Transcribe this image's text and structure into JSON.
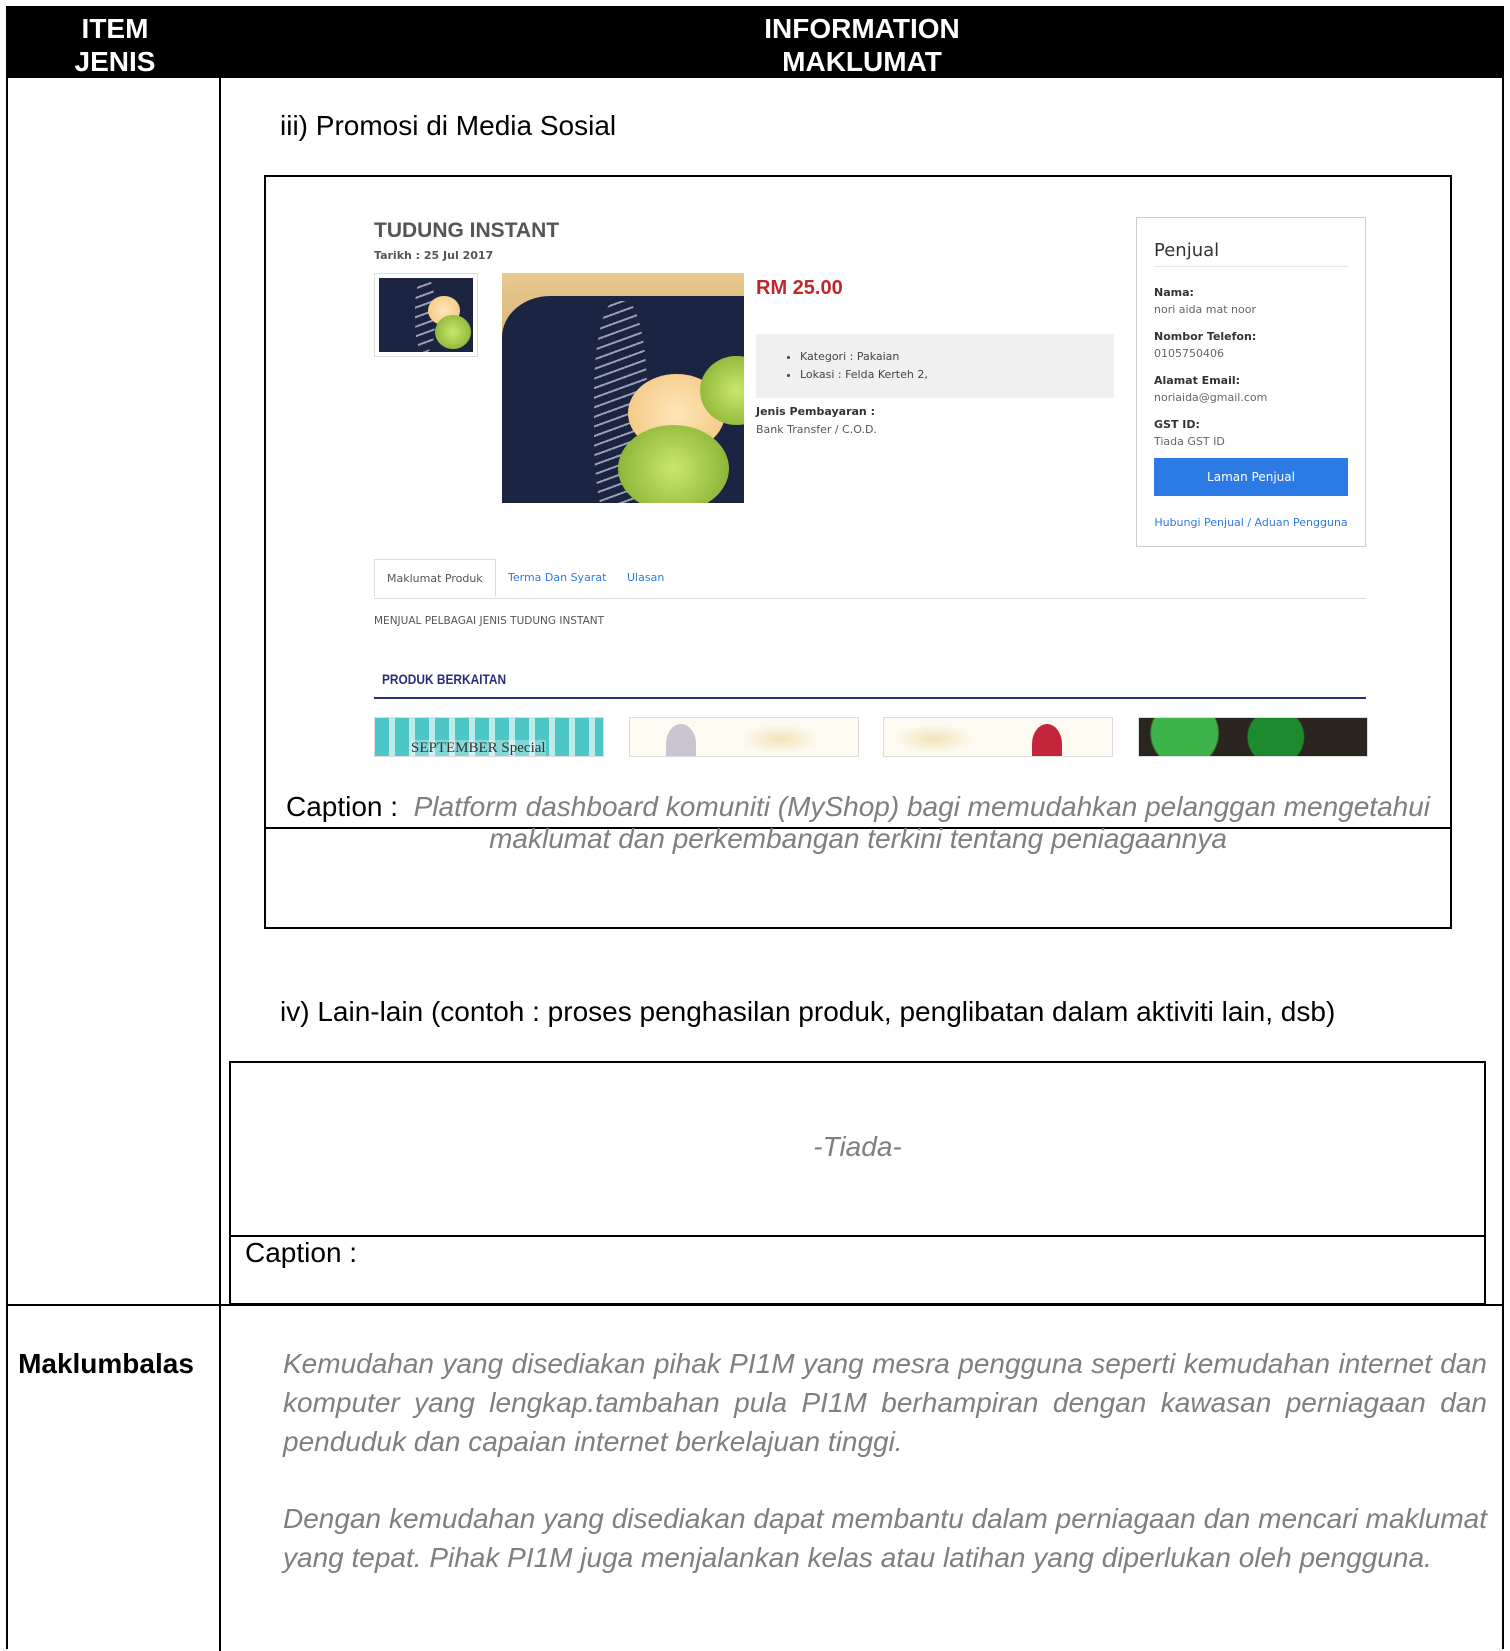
{
  "header": {
    "item_line1": "ITEM",
    "item_line2": "JENIS",
    "info_line1": "INFORMATION",
    "info_line2": "MAKLUMAT"
  },
  "section_iii": {
    "title": "iii)  Promosi di Media Sosial",
    "caption_label": "Caption :",
    "caption_text": "Platform dashboard komuniti (MyShop) bagi memudahkan pelanggan mengetahui maklumat dan perkembangan terkini tentang peniagaannya"
  },
  "product": {
    "title": "TUDUNG INSTANT",
    "date": "Tarikh : 25 Jul 2017",
    "price": "RM 25.00",
    "details": [
      "Kategori : Pakaian",
      "Lokasi : Felda Kerteh 2,"
    ],
    "payment_label": "Jenis Pembayaran :",
    "payment_value": "Bank Transfer / C.O.D.",
    "tabs": [
      "Maklumat Produk",
      "Terma Dan Syarat",
      "Ulasan"
    ],
    "description": "MENJUAL PELBAGAI JENIS TUDUNG INSTANT",
    "related_title": "PRODUK BERKAITAN",
    "related_banner": "SEPTEMBER Special"
  },
  "seller": {
    "heading": "Penjual",
    "name_label": "Nama:",
    "name_value": "nori aida mat noor",
    "phone_label": "Nombor Telefon:",
    "phone_value": "0105750406",
    "email_label": "Alamat Email:",
    "email_value": "noriaida@gmail.com",
    "gst_label": "GST ID:",
    "gst_value": "Tiada GST ID",
    "button_label": "Laman Penjual",
    "contact_link": "Hubungi Penjual / Aduan Pengguna"
  },
  "section_iv": {
    "title": "iv)  Lain-lain (contoh : proses penghasilan produk, penglibatan dalam aktiviti lain, dsb)",
    "placeholder": "-Tiada-",
    "caption_label": "Caption :"
  },
  "maklumbalas": {
    "label": "Maklumbalas",
    "paragraph1": "Kemudahan yang disediakan pihak PI1M yang mesra pengguna seperti kemudahan internet dan komputer yang lengkap.tambahan pula PI1M berhampiran dengan kawasan perniagaan dan penduduk dan capaian internet berkelajuan tinggi.",
    "paragraph2": "Dengan kemudahan yang disediakan dapat membantu dalam perniagaan dan mencari maklumat yang tepat. Pihak PI1M juga menjalankan kelas atau latihan yang diperlukan oleh pengguna."
  },
  "colors": {
    "header_bg": "#000000",
    "muted_text": "#7f7f7f",
    "price": "#c0272d",
    "link": "#2c7be5",
    "related_rule": "#2a2d7c"
  }
}
